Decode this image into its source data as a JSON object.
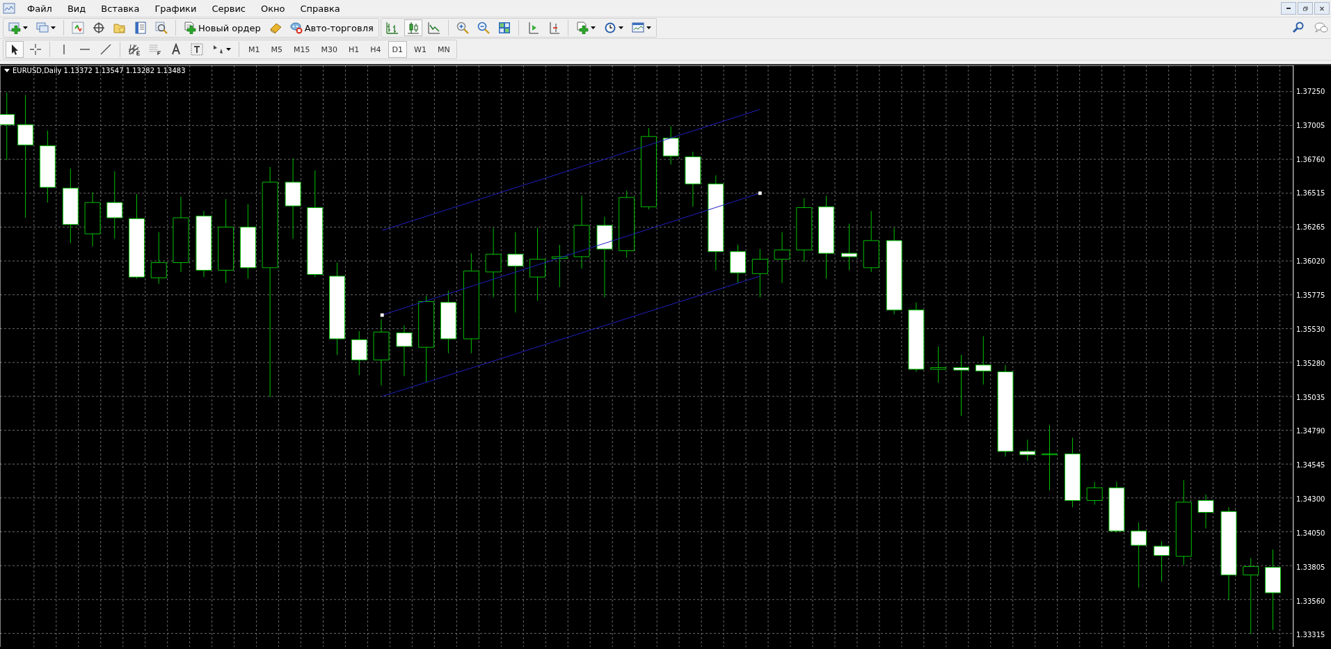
{
  "menu": [
    {
      "label": "Файл"
    },
    {
      "label": "Вид"
    },
    {
      "label": "Вставка"
    },
    {
      "label": "Графики"
    },
    {
      "label": "Сервис"
    },
    {
      "label": "Окно"
    },
    {
      "label": "Справка"
    }
  ],
  "toolbar": {
    "new_order": "Новый ордер",
    "auto_trading": "Авто-торговля",
    "chart_types": [
      {
        "kind": "bars",
        "selected": false
      },
      {
        "kind": "candles",
        "selected": true
      },
      {
        "kind": "line",
        "selected": false
      }
    ]
  },
  "tools": [
    {
      "kind": "cursor",
      "selected": true
    },
    {
      "kind": "crosshair",
      "selected": false
    },
    {
      "kind": "vline",
      "selected": false
    },
    {
      "kind": "hline",
      "selected": false
    },
    {
      "kind": "trendline",
      "selected": false
    },
    {
      "kind": "channel",
      "selected": false
    },
    {
      "kind": "fibo",
      "selected": false
    },
    {
      "kind": "text",
      "selected": false
    },
    {
      "kind": "label",
      "selected": false
    },
    {
      "kind": "arrows",
      "selected": false
    }
  ],
  "timeframes": [
    {
      "label": "M1",
      "selected": false
    },
    {
      "label": "M5",
      "selected": false
    },
    {
      "label": "M15",
      "selected": false
    },
    {
      "label": "M30",
      "selected": false
    },
    {
      "label": "H1",
      "selected": false
    },
    {
      "label": "H4",
      "selected": false
    },
    {
      "label": "D1",
      "selected": true
    },
    {
      "label": "W1",
      "selected": false
    },
    {
      "label": "MN",
      "selected": false
    }
  ],
  "chart": {
    "header": "EURUSD,Daily  1.13372 1.13547 1.13282 1.13483",
    "price_axis": [
      "1.37250",
      "1.37005",
      "1.36760",
      "1.36515",
      "1.36265",
      "1.36020",
      "1.35775",
      "1.35530",
      "1.35280",
      "1.35035",
      "1.34790",
      "1.34545",
      "1.34300",
      "1.34050",
      "1.33805",
      "1.33560",
      "1.33315"
    ]
  }
}
